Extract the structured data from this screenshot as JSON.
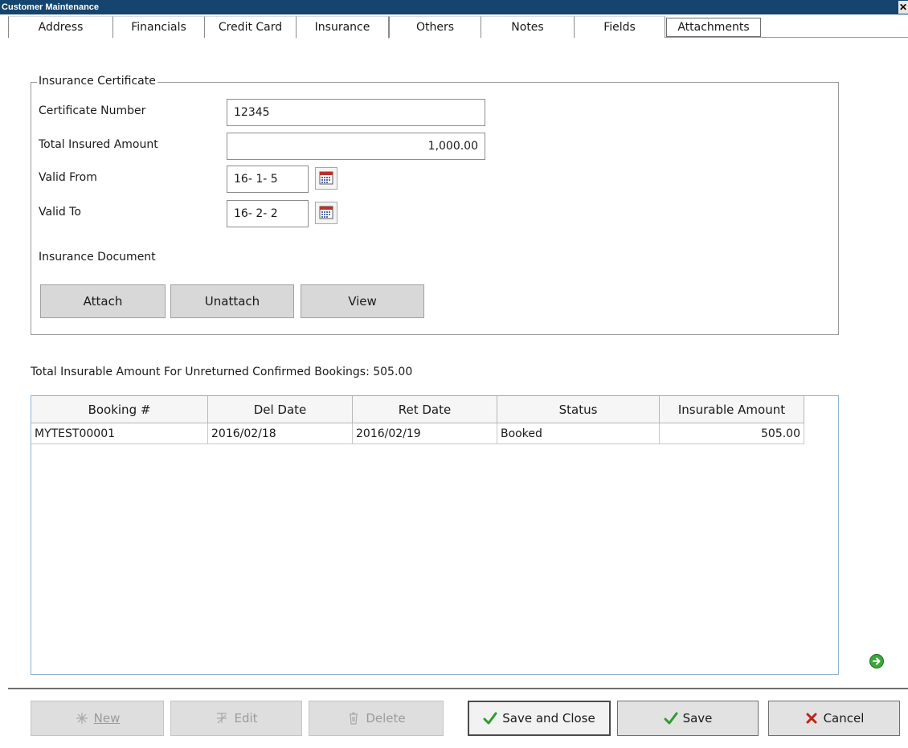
{
  "window": {
    "title": "Customer Maintenance",
    "close_glyph": "✕"
  },
  "tabs": [
    {
      "label": "Address"
    },
    {
      "label": "Financials"
    },
    {
      "label": "Credit Card"
    },
    {
      "label": "Insurance",
      "active": true
    },
    {
      "label": "Others"
    },
    {
      "label": "Notes"
    },
    {
      "label": "Fields"
    },
    {
      "label": "Attachments"
    }
  ],
  "insurance": {
    "group_title": "Insurance Certificate",
    "certificate_number_label": "Certificate Number",
    "certificate_number_value": "12345",
    "total_insured_label": "Total Insured Amount",
    "total_insured_value": "1,000.00",
    "valid_from_label": "Valid From",
    "valid_from_value": "16- 1- 5",
    "valid_to_label": "Valid To",
    "valid_to_value": "16- 2- 2",
    "document_label": "Insurance Document",
    "attach_label": "Attach",
    "unattach_label": "Unattach",
    "view_label": "View"
  },
  "summary": {
    "text": "Total Insurable Amount For Unreturned Confirmed Bookings: 505.00"
  },
  "bookings": {
    "columns": [
      "Booking #",
      "Del Date",
      "Ret Date",
      "Status",
      "Insurable Amount"
    ],
    "rows": [
      [
        "MYTEST00001",
        "2016/02/18",
        "2016/02/19",
        "Booked",
        "505.00"
      ]
    ]
  },
  "footer": {
    "new_label": "New",
    "edit_label": "Edit",
    "delete_label": "Delete",
    "save_close_label": "Save and Close",
    "save_label": "Save",
    "cancel_label": "Cancel"
  },
  "icons": {
    "calendar": "calendar-icon",
    "next": "next-arrow-icon",
    "new": "new-sparkle-icon",
    "edit": "edit-icon",
    "delete": "trash-icon",
    "save": "checkmark-icon",
    "cancel": "x-icon"
  },
  "colors": {
    "titlebar": "#15456e",
    "check_green": "#2e9e2e",
    "cancel_red": "#c0221b",
    "grid_border": "#8fb3d0"
  }
}
